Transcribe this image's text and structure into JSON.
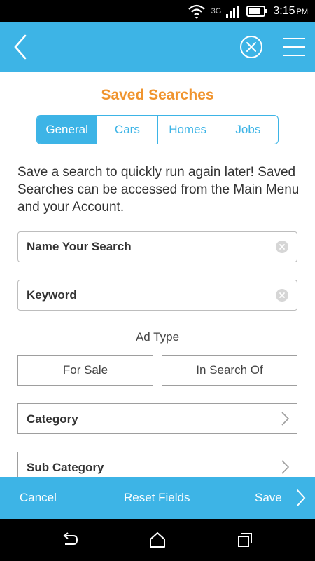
{
  "status_bar": {
    "network": "3G",
    "time": "3:15",
    "ampm": "PM",
    "icons": [
      "wifi-icon",
      "signal-icon",
      "battery-icon"
    ]
  },
  "app_bar": {
    "back_icon": "chevron-left-icon",
    "clear_icon": "close-circle-icon",
    "menu_icon": "hamburger-menu-icon",
    "color": "#3db4e6"
  },
  "page": {
    "title": "Saved Searches",
    "title_color": "#f0942e",
    "tabs": [
      {
        "label": "General",
        "active": true
      },
      {
        "label": "Cars",
        "active": false
      },
      {
        "label": "Homes",
        "active": false
      },
      {
        "label": "Jobs",
        "active": false
      }
    ],
    "description": "Save a search to quickly run again later! Saved Searches can be accessed from the Main Menu and your Account.",
    "fields": {
      "name": {
        "value": "",
        "placeholder": "Name Your Search"
      },
      "keyword": {
        "value": "",
        "placeholder": "Keyword"
      }
    },
    "ad_type": {
      "label": "Ad Type",
      "options": [
        "For Sale",
        "In Search Of"
      ]
    },
    "selects": {
      "category": "Category",
      "sub_category": "Sub Category"
    }
  },
  "bottom_bar": {
    "cancel": "Cancel",
    "reset": "Reset Fields",
    "save": "Save"
  },
  "nav_bar": {
    "icons": [
      "back-nav-icon",
      "home-nav-icon",
      "recents-nav-icon"
    ]
  }
}
